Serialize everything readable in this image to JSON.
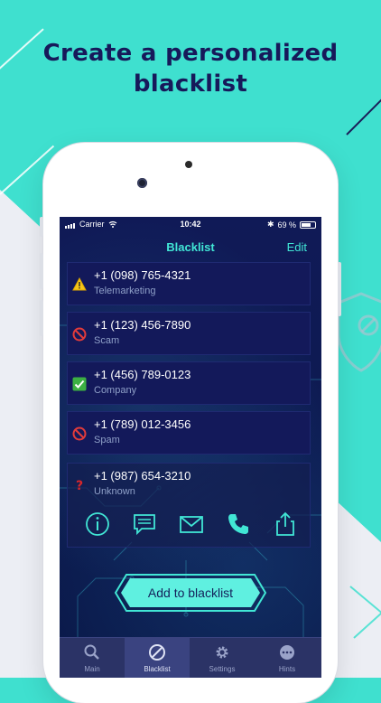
{
  "headline": "Create a personalized blacklist",
  "status_bar": {
    "carrier": "Carrier",
    "time": "10:42",
    "battery": "69 %"
  },
  "nav": {
    "title": "Blacklist",
    "edit_label": "Edit"
  },
  "rows": [
    {
      "number": "+1 (098) 765-4321",
      "label": "Telemarketing",
      "icon": "warning-icon"
    },
    {
      "number": "+1 (123) 456-7890",
      "label": "Scam",
      "icon": "blocked-icon"
    },
    {
      "number": "+1 (456) 789-0123",
      "label": "Company",
      "icon": "check-icon"
    },
    {
      "number": "+1 (789) 012-3456",
      "label": "Spam",
      "icon": "blocked-icon"
    },
    {
      "number": "+1 (987) 654-3210",
      "label": "Unknown",
      "icon": "question-icon"
    }
  ],
  "row_actions": [
    "info-icon",
    "message-icon",
    "mail-icon",
    "call-icon",
    "share-icon"
  ],
  "add_button": {
    "label": "Add to blacklist"
  },
  "tabs": [
    {
      "label": "Main",
      "icon": "search-icon"
    },
    {
      "label": "Blacklist",
      "icon": "blocked-icon",
      "active": true
    },
    {
      "label": "Settings",
      "icon": "gear-icon"
    },
    {
      "label": "Hints",
      "icon": "more-icon"
    }
  ],
  "colors": {
    "accent": "#41e6d5",
    "background": "#3fe0cf",
    "headline": "#17195a",
    "screen": "#0d1547"
  }
}
